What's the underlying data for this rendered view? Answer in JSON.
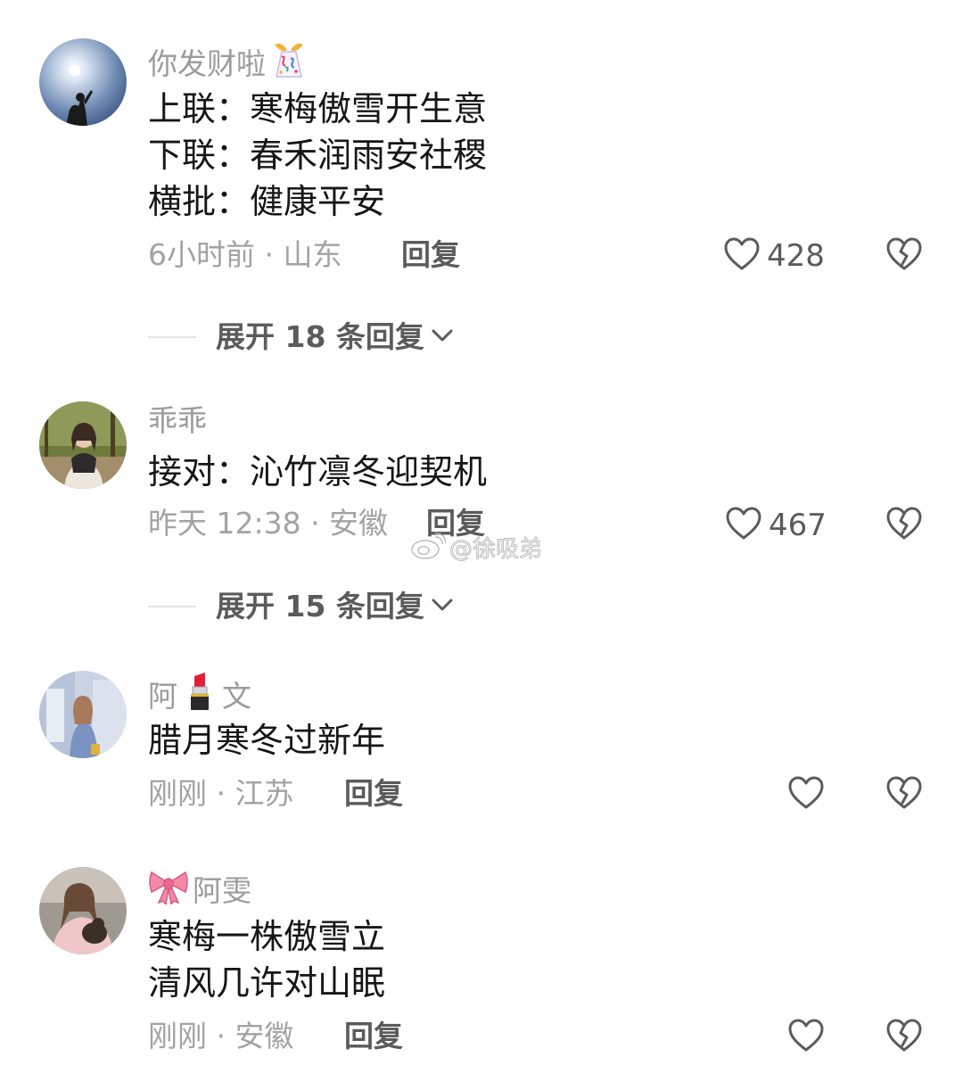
{
  "comments": [
    {
      "username": "你发财啦",
      "name_emoji": "confetti-icon",
      "lines": [
        "上联：寒梅傲雪开生意",
        "下联：春禾润雨安社稷",
        "横批：健康平安"
      ],
      "meta": "6小时前 · 山东",
      "reply_label": "回复",
      "likes": "428",
      "expand_label": "展开 18 条回复"
    },
    {
      "username": "乖乖",
      "lines": [
        "接对：沁竹凛冬迎契机"
      ],
      "meta": "昨天 12:38 · 安徽",
      "reply_label": "回复",
      "likes": "467",
      "expand_label": "展开 15 条回复"
    },
    {
      "username_parts": [
        "阿",
        "文"
      ],
      "name_emoji": "lipstick-icon",
      "lines": [
        "腊月寒冬过新年"
      ],
      "meta": "刚刚 · 江苏",
      "reply_label": "回复"
    },
    {
      "username": "阿雯",
      "name_emoji": "ribbon-icon",
      "lines": [
        "寒梅一株傲雪立",
        "清风几许对山眠"
      ],
      "meta": "刚刚 · 安徽",
      "reply_label": "回复"
    }
  ],
  "watermark": "@徐吸弟",
  "colors": {
    "primary_text": "#161616",
    "secondary_text": "#9b9b9b",
    "action_text": "#5b5b5b"
  }
}
